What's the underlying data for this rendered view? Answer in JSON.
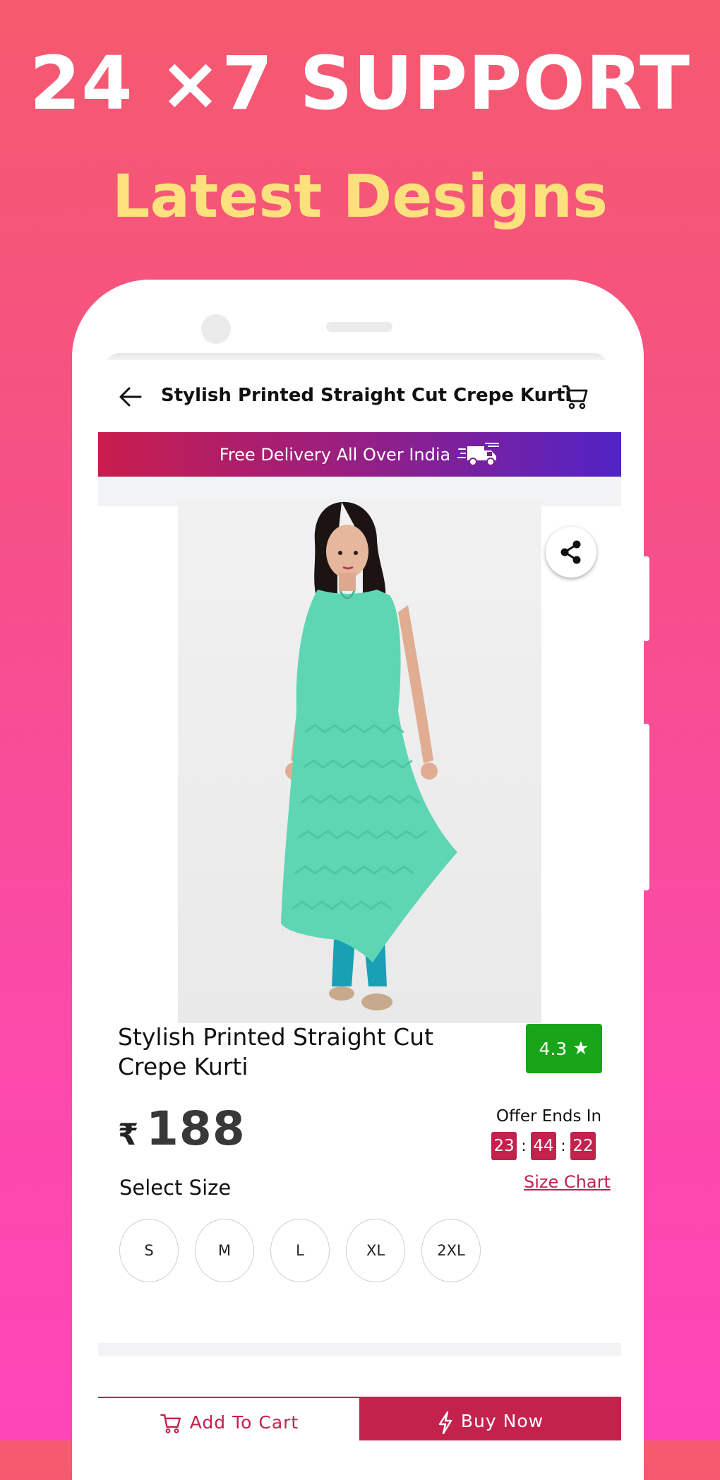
{
  "promo": {
    "headline": "24 ×7 SUPPORT",
    "subheadline": "Latest Designs"
  },
  "appbar": {
    "title": "Stylish Printed Straight Cut Crepe Kurti"
  },
  "banner": {
    "text": "Free Delivery All Over India"
  },
  "product": {
    "name": "Stylish Printed Straight Cut Crepe Kurti",
    "rating": "4.3",
    "currency_symbol": "₹",
    "price": "188"
  },
  "offer": {
    "label": "Offer Ends In",
    "hours": "23",
    "minutes": "44",
    "seconds": "22",
    "separator": ":"
  },
  "size": {
    "label": "Select Size",
    "chart_link": "Size Chart",
    "options": [
      "S",
      "M",
      "L",
      "XL",
      "2XL"
    ]
  },
  "actions": {
    "add_to_cart": "Add To Cart",
    "buy_now": "Buy Now"
  },
  "colors": {
    "brand": "#c2224c",
    "rating_green": "#18a51a",
    "timer_bg": "#c2224c",
    "headline_yellow": "#fde17c"
  },
  "icons": {
    "back": "arrow-left-icon",
    "cart": "shopping-cart-icon",
    "truck": "delivery-truck-icon",
    "share": "share-icon",
    "star": "star-icon",
    "bolt": "lightning-bolt-icon"
  }
}
